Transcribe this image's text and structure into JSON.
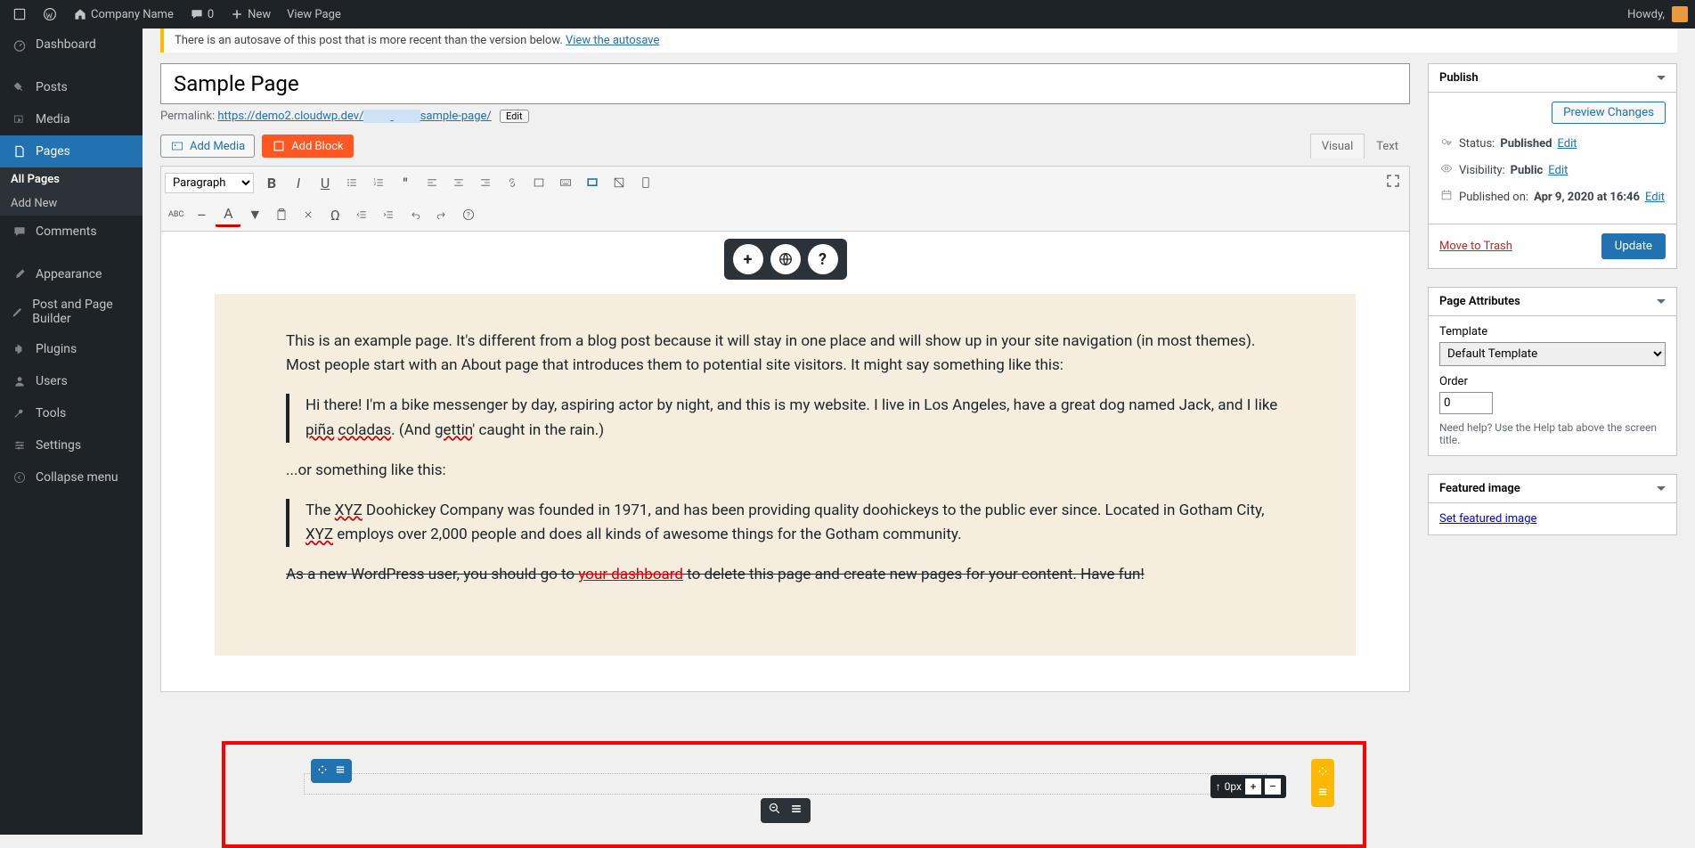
{
  "topbar": {
    "site_name": "Company Name",
    "comments": "0",
    "new": "New",
    "view": "View Page",
    "howdy": "Howdy,"
  },
  "sidebar": {
    "items": [
      {
        "icon": "dashboard",
        "label": "Dashboard"
      },
      {
        "icon": "pin",
        "label": "Posts"
      },
      {
        "icon": "media",
        "label": "Media"
      },
      {
        "icon": "page",
        "label": "Pages",
        "active": true
      },
      {
        "icon": "comment",
        "label": "Comments"
      },
      {
        "icon": "brush",
        "label": "Appearance"
      },
      {
        "icon": "builder",
        "label": "Post and Page Builder"
      },
      {
        "icon": "plugin",
        "label": "Plugins"
      },
      {
        "icon": "user",
        "label": "Users"
      },
      {
        "icon": "wrench",
        "label": "Tools"
      },
      {
        "icon": "settings",
        "label": "Settings"
      },
      {
        "icon": "collapse",
        "label": "Collapse menu"
      }
    ],
    "submenu": [
      "All Pages",
      "Add New"
    ]
  },
  "notice": {
    "text": "There is an autosave of this post that is more recent than the version below. ",
    "link": "View the autosave"
  },
  "title": "Sample Page",
  "permalink": {
    "label": "Permalink:",
    "base": "https://demo2.cloudwp.dev/",
    "slug": "sample-page/",
    "edit": "Edit"
  },
  "media": {
    "add_media": "Add Media",
    "add_block": "Add Block"
  },
  "tabs": {
    "visual": "Visual",
    "text": "Text"
  },
  "toolbar": {
    "format": "Paragraph",
    "abc": "ABC"
  },
  "content": {
    "p1": "This is an example page. It's different from a blog post because it will stay in one place and will show up in your site navigation (in most themes). Most people start with an About page that introduces them to potential site visitors. It might say something like this:",
    "q1a": "Hi there! I'm a bike messenger by day, aspiring actor by night, and this is my website. I live in Los Angeles, have a great dog named Jack, and I like ",
    "q1b": "piña",
    "q1c": " ",
    "q1d": "coladas",
    "q1e": ". (And ",
    "q1f": "gettin",
    "q1g": "' caught in the rain.)",
    "p2": "...or something like this:",
    "q2a": "The ",
    "q2b": "XYZ",
    "q2c": " Doohickey Company was founded in 1971, and has been providing quality doohickeys to the public ever since. Located in Gotham City, ",
    "q2d": "XYZ",
    "q2e": " employs over 2,000 people and does all kinds of awesome things for the Gotham community.",
    "p3a": "As a new WordPress user, you should go to ",
    "p3b": "your dashboard",
    "p3c": " to delete this page and create new pages for your content. Have fun!"
  },
  "margin": {
    "label": "0px"
  },
  "publish": {
    "title": "Publish",
    "preview": "Preview Changes",
    "status_label": "Status:",
    "status": "Published",
    "edit": "Edit",
    "visibility_label": "Visibility:",
    "visibility": "Public",
    "published_label": "Published on:",
    "published": "Apr 9, 2020 at 16:46",
    "trash": "Move to Trash",
    "update": "Update"
  },
  "attributes": {
    "title": "Page Attributes",
    "template_label": "Template",
    "template": "Default Template",
    "order_label": "Order",
    "order": "0",
    "help": "Need help? Use the Help tab above the screen title."
  },
  "featured": {
    "title": "Featured image",
    "link": "Set featured image"
  }
}
